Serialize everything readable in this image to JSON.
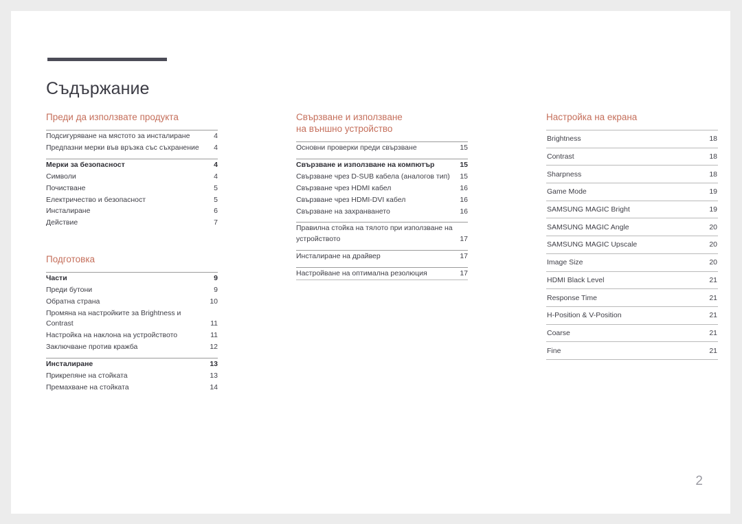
{
  "document": {
    "title": "Съдържание",
    "folio": "2",
    "accent_color": "#c56f5b",
    "rule_color": "#4b4b57",
    "text_color": "#3e3e46",
    "folio_color": "#9b9ba3",
    "page_background": "#ffffff",
    "canvas_background": "#ececec"
  },
  "columns": [
    {
      "id": "column-1",
      "sections": [
        {
          "heading": "Преди да използвате продукта",
          "groups": [
            {
              "entries": [
                {
                  "label": "Подсигуряване на мястото за инсталиране",
                  "page": "4",
                  "bold": false
                },
                {
                  "label": "Предпазни мерки във връзка със съхранение",
                  "page": "4",
                  "bold": false
                }
              ]
            },
            {
              "entries": [
                {
                  "label": "Мерки за безопасност",
                  "page": "4",
                  "bold": true
                },
                {
                  "label": "Символи",
                  "page": "4",
                  "bold": false
                },
                {
                  "label": "Почистване",
                  "page": "5",
                  "bold": false
                },
                {
                  "label": "Електричество и безопасност",
                  "page": "5",
                  "bold": false
                },
                {
                  "label": "Инсталиране",
                  "page": "6",
                  "bold": false
                },
                {
                  "label": "Действие",
                  "page": "7",
                  "bold": false
                }
              ]
            }
          ]
        },
        {
          "heading": "Подготовка",
          "groups": [
            {
              "entries": [
                {
                  "label": "Части",
                  "page": "9",
                  "bold": true
                },
                {
                  "label": "Преди бутони",
                  "page": "9",
                  "bold": false
                },
                {
                  "label": "Обратна страна",
                  "page": "10",
                  "bold": false
                },
                {
                  "label": "Промяна на настройките за Brightness и\nContrast",
                  "page": "11",
                  "bold": false,
                  "wrap": true
                },
                {
                  "label": "Настройка на наклона на устройството",
                  "page": "11",
                  "bold": false
                },
                {
                  "label": "Заключване против кражба",
                  "page": "12",
                  "bold": false
                }
              ]
            },
            {
              "entries": [
                {
                  "label": "Инсталиране",
                  "page": "13",
                  "bold": true
                },
                {
                  "label": "Прикрепяне на стойката",
                  "page": "13",
                  "bold": false
                },
                {
                  "label": "Премахване на стойката",
                  "page": "14",
                  "bold": false
                }
              ]
            }
          ]
        }
      ]
    },
    {
      "id": "column-2",
      "sections": [
        {
          "heading": "Свързване и използване\nна външно устройство",
          "groups": [
            {
              "entries": [
                {
                  "label": "Основни проверки преди свързване",
                  "page": "15",
                  "bold": false
                }
              ]
            },
            {
              "entries": [
                {
                  "label": "Свързване и използване на компютър",
                  "page": "15",
                  "bold": true
                },
                {
                  "label": "Свързване чрез D-SUB кабела (аналогов тип)",
                  "page": "15",
                  "bold": false
                },
                {
                  "label": "Свързване чрез HDMI кабел",
                  "page": "16",
                  "bold": false
                },
                {
                  "label": "Свързване чрез HDMI-DVI кабел",
                  "page": "16",
                  "bold": false
                },
                {
                  "label": "Свързване на захранването",
                  "page": "16",
                  "bold": false
                }
              ]
            },
            {
              "entries": [
                {
                  "label": "Правилна стойка на тялото при използване на\nустройството",
                  "page": "17",
                  "bold": false,
                  "wrap": true
                }
              ]
            },
            {
              "entries": [
                {
                  "label": "Инсталиране на драйвер",
                  "page": "17",
                  "bold": false
                }
              ]
            },
            {
              "entries": [
                {
                  "label": "Настройване на оптимална резолюция",
                  "page": "17",
                  "bold": false
                }
              ]
            }
          ]
        }
      ]
    },
    {
      "id": "column-3",
      "sections": [
        {
          "heading": "Настройка на екрана",
          "rows": [
            {
              "label": "Brightness",
              "page": "18"
            },
            {
              "label": "Contrast",
              "page": "18"
            },
            {
              "label": "Sharpness",
              "page": "18"
            },
            {
              "label": "Game Mode",
              "page": "19"
            },
            {
              "label": "SAMSUNG MAGIC Bright",
              "page": "19"
            },
            {
              "label": "SAMSUNG MAGIC Angle",
              "page": "20"
            },
            {
              "label": "SAMSUNG MAGIC Upscale",
              "page": "20"
            },
            {
              "label": "Image Size",
              "page": "20"
            },
            {
              "label": "HDMI Black Level",
              "page": "21"
            },
            {
              "label": "Response Time",
              "page": "21"
            },
            {
              "label": "H-Position & V-Position",
              "page": "21"
            },
            {
              "label": "Coarse",
              "page": "21"
            },
            {
              "label": "Fine",
              "page": "21"
            }
          ]
        }
      ]
    }
  ]
}
